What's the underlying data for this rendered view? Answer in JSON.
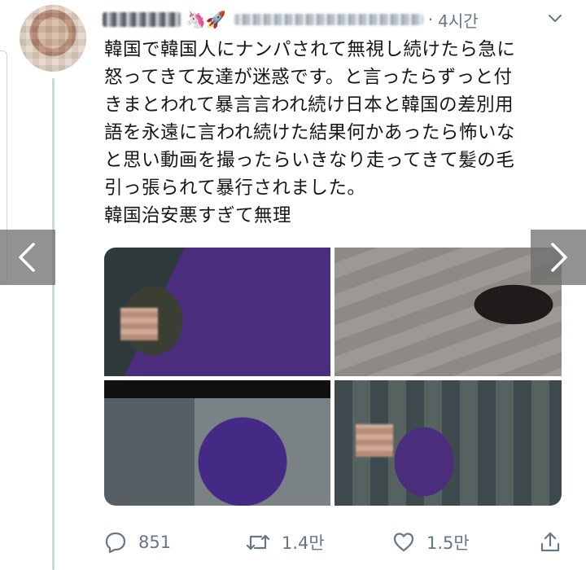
{
  "header": {
    "name_emoji": "🦄🚀",
    "time": "4시간"
  },
  "tweet": {
    "lines": [
      "韓国で韓国人にナンパされて無視し続けたら急に",
      "怒ってきて友達が迷惑です。と言ったらずっと付",
      "きまとわれて暴言言われ続け日本と韓国の差別用",
      "語を永遠に言われ続けた結果何かあったら怖いな",
      "と思い動画を撮ったらいきなり走ってきて髪の毛",
      "引っ張られて暴行されました。",
      "韓国治安悪すぎて無理"
    ]
  },
  "actions": {
    "reply_count": "851",
    "retweet_count": "1.4만",
    "like_count": "1.5만"
  },
  "colors": {
    "text": "#14171a",
    "secondary": "#657786",
    "thread_line": "#ccd6dd"
  }
}
